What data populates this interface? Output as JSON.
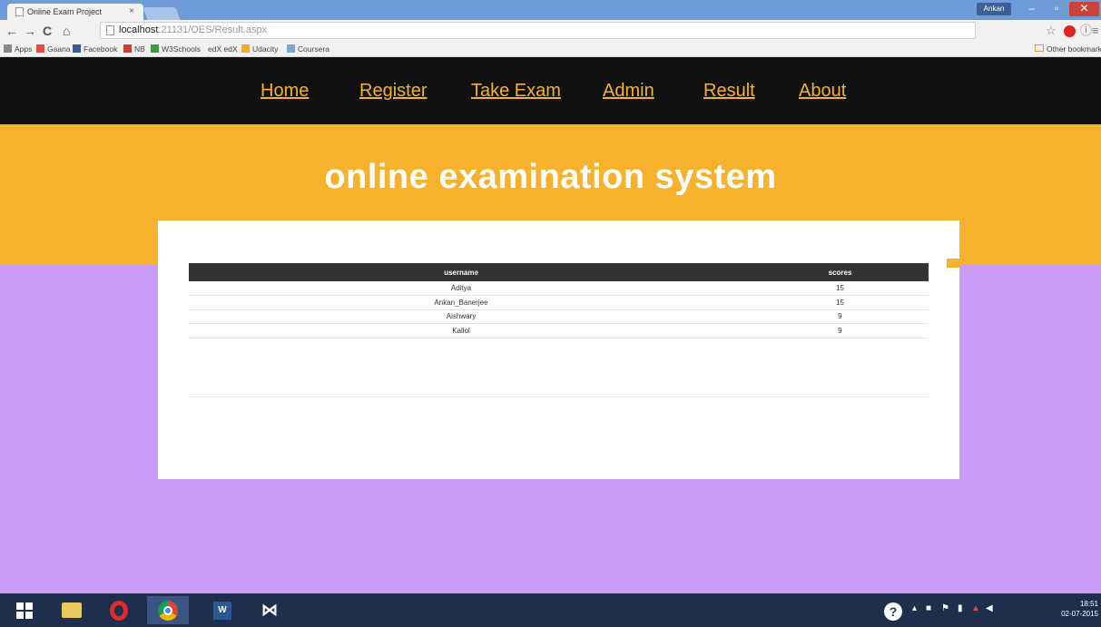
{
  "browser": {
    "tab_title": "Online Exam Project",
    "tab_close": "×",
    "user_name": "Ankan",
    "win_min": "–",
    "win_max": "▫",
    "win_close": "✕",
    "url_host": "localhost",
    "url_path": ":21131/OES/Result.aspx",
    "bookmarks": [
      "Apps",
      "Gaana",
      "Facebook",
      "NB",
      "W3Schools",
      "edX edX",
      "Udacity",
      "Coursera"
    ],
    "other_bookmarks": "Other bookmarks"
  },
  "site": {
    "nav": [
      "Home",
      "Register",
      "Take Exam",
      "Admin",
      "Result",
      "About"
    ],
    "title": "online examination system"
  },
  "results": {
    "headers": [
      "username",
      "scores"
    ],
    "rows": [
      [
        "Aditya",
        "15"
      ],
      [
        "Ankan_Banerjee",
        "15"
      ],
      [
        "Aishwary",
        "9"
      ],
      [
        "Kallol",
        "9"
      ]
    ]
  },
  "taskbar": {
    "help": "?",
    "time": "18:51",
    "date": "02-07-2015"
  },
  "colors": {
    "nav_bg": "#111111",
    "nav_link": "#f7b228",
    "hero_bg": "#f6b22c",
    "page_bg": "#c99cf7",
    "table_header_bg": "#333333"
  }
}
